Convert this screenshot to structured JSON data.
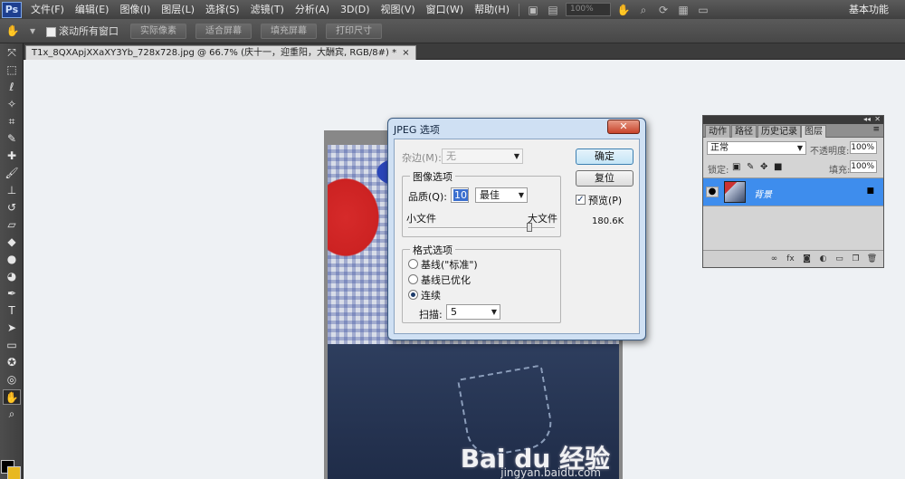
{
  "menubar": {
    "logo": "Ps",
    "items": [
      "文件(F)",
      "编辑(E)",
      "图像(I)",
      "图层(L)",
      "选择(S)",
      "滤镜(T)",
      "分析(A)",
      "3D(D)",
      "视图(V)",
      "窗口(W)",
      "帮助(H)"
    ],
    "zoom": "100%",
    "workspace": "基本功能"
  },
  "options": {
    "scroll_all": "滚动所有窗口",
    "actual_pixels": "实际像素",
    "fit_screen": "适合屏幕",
    "fill_screen": "填充屏幕",
    "print_size": "打印尺寸"
  },
  "document": {
    "tab_title": "T1x_8QXApjXXaXY3Yb_728x728.jpg @ 66.7% (庆十一，迎重阳，大酬宾, RGB/8#) *",
    "close": "×"
  },
  "watermark": {
    "brand": "Bai du 经验",
    "url": "jingyan.baidu.com"
  },
  "dialog": {
    "title": "JPEG 选项",
    "close": "✕",
    "matte_label": "杂边(M):",
    "matte_value": "无",
    "image_options_title": "图像选项",
    "quality_label": "品质(Q):",
    "quality_value": "10",
    "quality_preset": "最佳",
    "small_file": "小文件",
    "large_file": "大文件",
    "quality_slider": 0.83,
    "format_options_title": "格式选项",
    "format_options": [
      "基线(\"标准\")",
      "基线已优化",
      "连续"
    ],
    "format_selected": 2,
    "scans_label": "扫描:",
    "scans_value": "5",
    "ok": "确定",
    "reset": "复位",
    "preview_label": "预览(P)",
    "preview_checked": true,
    "file_size": "180.6K"
  },
  "layers_panel": {
    "tabs": [
      "动作",
      "路径",
      "历史记录",
      "图层"
    ],
    "active_tab": 3,
    "blend_mode": "正常",
    "opacity_label": "不透明度:",
    "opacity": "100%",
    "lock_label": "锁定:",
    "fill_label": "填充:",
    "fill": "100%",
    "layer_name": "背景"
  },
  "colors": {
    "foreground": "#000000",
    "background": "#e8b820",
    "selection": "#3e8ded"
  }
}
